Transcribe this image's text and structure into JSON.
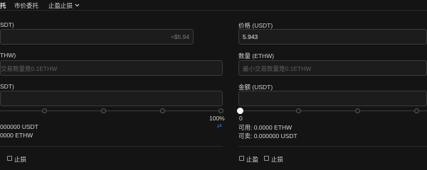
{
  "tabs": [
    {
      "label": "托"
    },
    {
      "label": "市价委托"
    },
    {
      "label": "止盈止损"
    }
  ],
  "left": {
    "price_label": "SDT)",
    "price_suffix": "≈$5.94",
    "amount_label": "THW)",
    "amount_placeholder": "交易数量是0.1ETHW",
    "total_label": "SDT)",
    "slider_max_label": "100%",
    "slider_level_percent": 100,
    "available": "000000 USDT",
    "sellable": "0000 ETHW",
    "stop_loss_label": "止损"
  },
  "right": {
    "price_label": "价格 (USDT)",
    "price_value": "5.943",
    "amount_label": "数量 (ETHW)",
    "amount_placeholder": "最小交易数量是0.1ETHW",
    "total_label": "金额 (USDT)",
    "slider_min_label": "0",
    "slider_level_percent": 0,
    "available": "可用: 0.0000 ETHW",
    "sellable": "可卖: 0.000000 USDT",
    "take_profit_label": "止盈",
    "stop_loss_label": "止损"
  },
  "icons": {
    "tab_dropdown": "chevron-down-icon",
    "swap": "swap-arrows-icon"
  },
  "colors": {
    "background": "#141414",
    "input_bg": "#1c1c1c",
    "accent_blue": "#3b72d9"
  }
}
